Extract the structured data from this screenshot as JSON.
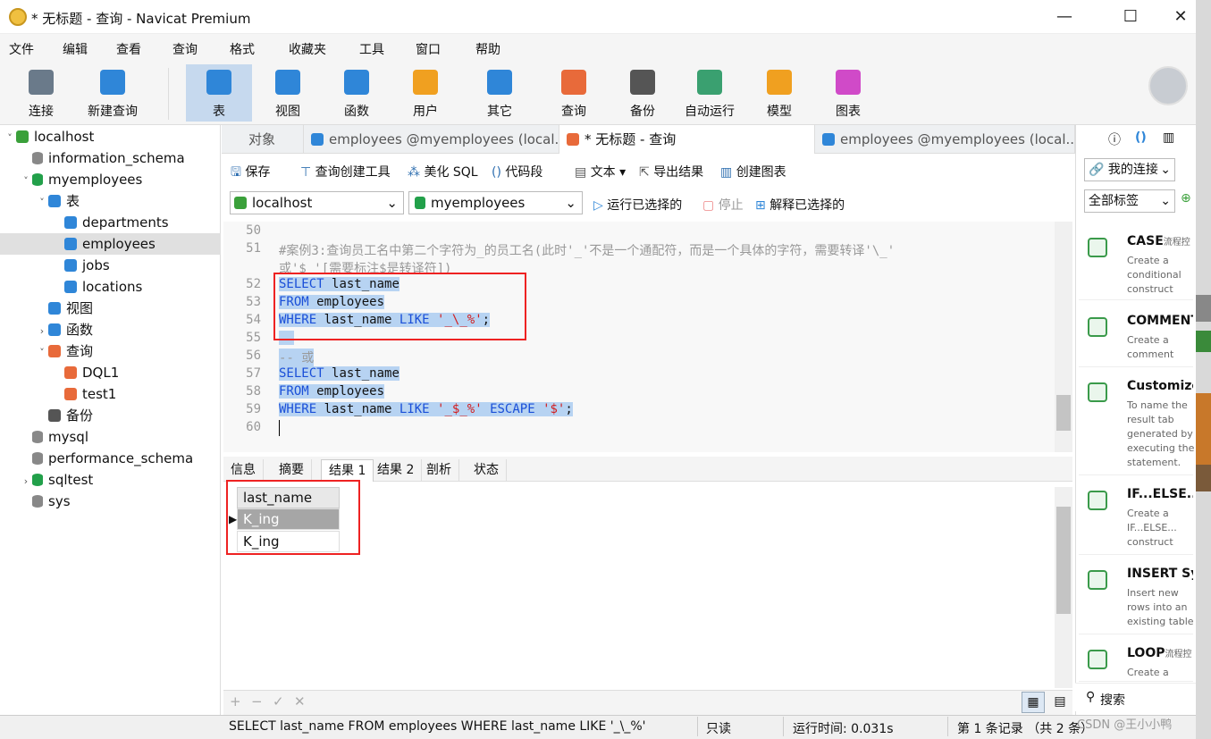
{
  "window": {
    "title": "* 无标题 - 查询 - Navicat Premium",
    "minimize": "—",
    "maximize": "☐",
    "close": "✕"
  },
  "menu": [
    "文件",
    "编辑",
    "查看",
    "查询",
    "格式",
    "收藏夹",
    "工具",
    "窗口",
    "帮助"
  ],
  "toolbar": [
    {
      "label": "连接",
      "icon": "plug-icon",
      "color": "#6a7a8a"
    },
    {
      "label": "新建查询",
      "icon": "new-query-icon",
      "color": "#2f86d8"
    },
    {
      "label": "表",
      "icon": "table-icon",
      "color": "#2f86d8"
    },
    {
      "label": "视图",
      "icon": "view-icon",
      "color": "#2f86d8"
    },
    {
      "label": "函数",
      "icon": "function-icon",
      "color": "#2f86d8"
    },
    {
      "label": "用户",
      "icon": "user-icon",
      "color": "#f0a020"
    },
    {
      "label": "其它",
      "icon": "tools-icon",
      "color": "#2f86d8"
    },
    {
      "label": "查询",
      "icon": "query-icon",
      "color": "#e86a3a"
    },
    {
      "label": "备份",
      "icon": "backup-icon",
      "color": "#555555"
    },
    {
      "label": "自动运行",
      "icon": "robot-icon",
      "color": "#3aa070"
    },
    {
      "label": "模型",
      "icon": "model-icon",
      "color": "#f0a020"
    },
    {
      "label": "图表",
      "icon": "chart-icon",
      "color": "#d04ac8"
    }
  ],
  "sidebar": [
    {
      "label": "localhost",
      "indent": 0,
      "arrow": "˅",
      "icon": "connection-icon",
      "color": "#3aa03a"
    },
    {
      "label": "information_schema",
      "indent": 1,
      "arrow": "",
      "icon": "database-icon",
      "color": "#888888"
    },
    {
      "label": "myemployees",
      "indent": 1,
      "arrow": "˅",
      "icon": "database-icon",
      "color": "#22a04a"
    },
    {
      "label": "表",
      "indent": 2,
      "arrow": "˅",
      "icon": "tables-folder-icon",
      "color": "#2f86d8"
    },
    {
      "label": "departments",
      "indent": 3,
      "arrow": "",
      "icon": "table-icon",
      "color": "#2f86d8"
    },
    {
      "label": "employees",
      "indent": 3,
      "arrow": "",
      "icon": "table-icon",
      "color": "#2f86d8",
      "selected": true
    },
    {
      "label": "jobs",
      "indent": 3,
      "arrow": "",
      "icon": "table-icon",
      "color": "#2f86d8"
    },
    {
      "label": "locations",
      "indent": 3,
      "arrow": "",
      "icon": "table-icon",
      "color": "#2f86d8"
    },
    {
      "label": "视图",
      "indent": 2,
      "arrow": "",
      "icon": "view-icon",
      "color": "#2f86d8"
    },
    {
      "label": "函数",
      "indent": 2,
      "arrow": "›",
      "icon": "function-icon",
      "color": "#2f86d8"
    },
    {
      "label": "查询",
      "indent": 2,
      "arrow": "˅",
      "icon": "query-icon",
      "color": "#e86a3a"
    },
    {
      "label": "DQL1",
      "indent": 3,
      "arrow": "",
      "icon": "query-icon",
      "color": "#e86a3a"
    },
    {
      "label": "test1",
      "indent": 3,
      "arrow": "",
      "icon": "query-icon",
      "color": "#e86a3a"
    },
    {
      "label": "备份",
      "indent": 2,
      "arrow": "",
      "icon": "backup-icon",
      "color": "#555555"
    },
    {
      "label": "mysql",
      "indent": 1,
      "arrow": "",
      "icon": "database-icon",
      "color": "#888888"
    },
    {
      "label": "performance_schema",
      "indent": 1,
      "arrow": "",
      "icon": "database-icon",
      "color": "#888888"
    },
    {
      "label": "sqltest",
      "indent": 1,
      "arrow": "›",
      "icon": "database-icon",
      "color": "#22a04a"
    },
    {
      "label": "sys",
      "indent": 1,
      "arrow": "",
      "icon": "database-icon",
      "color": "#888888"
    }
  ],
  "tabs": {
    "objects": "对象",
    "tab1": "employees @myemployees (local...",
    "tab2": "* 无标题 - 查询",
    "tab3": "employees @myemployees (local..."
  },
  "query_toolbar": {
    "save": "保存",
    "builder": "查询创建工具",
    "beautify": "美化 SQL",
    "snippet": "代码段",
    "text": "文本",
    "export": "导出结果",
    "create_chart": "创建图表"
  },
  "selectors": {
    "connection": "localhost",
    "database": "myemployees",
    "run": "运行已选择的",
    "stop": "停止",
    "explain": "解释已选择的"
  },
  "editor": {
    "lines": [
      {
        "n": "50",
        "text": ""
      },
      {
        "n": "51",
        "text": "#案例3:查询员工名中第二个字符为_的员工名(此时'_'不是一个通配符，而是一个具体的字符，需要转译'\\_'"
      },
      {
        "n": "",
        "text": "或'$ '[需要标注$是转译符])"
      },
      {
        "n": "52",
        "text": "SELECT last_name"
      },
      {
        "n": "53",
        "text": "FROM employees"
      },
      {
        "n": "54",
        "text": "WHERE last_name LIKE '_\\_%';"
      },
      {
        "n": "55",
        "text": ""
      },
      {
        "n": "56",
        "text": "-- 或"
      },
      {
        "n": "57",
        "text": "SELECT last_name"
      },
      {
        "n": "58",
        "text": "FROM employees"
      },
      {
        "n": "59",
        "text": "WHERE last_name LIKE '_$_%' ESCAPE '$';"
      },
      {
        "n": "60",
        "text": ""
      }
    ],
    "kw_select": "SELECT",
    "kw_from": "FROM",
    "kw_where": "WHERE",
    "kw_like": "LIKE",
    "kw_escape": "ESCAPE",
    "col": "last_name",
    "tbl": "employees",
    "str1": "'_\\_%'",
    "str2": "'_$_%'",
    "str3": "'$'",
    "semi": ";",
    "comment": "-- 或"
  },
  "result_tabs": [
    "信息",
    "摘要",
    "结果 1",
    "结果 2",
    "剖析",
    "状态"
  ],
  "result": {
    "column": "last_name",
    "rows": [
      "K_ing",
      "K_ing"
    ]
  },
  "bottom_controls": [
    "+",
    "−",
    "✓",
    "✕"
  ],
  "status": {
    "sql": "SELECT last_name FROM employees WHERE last_name LIKE '_\\_%'",
    "readonly": "只读",
    "runtime": "运行时间: 0.031s",
    "records": "第 1 条记录 （共 2 条）",
    "watermark": "CSDN @王小小鸭"
  },
  "right_panel": {
    "connection_dropdown": "我的连接",
    "tags_dropdown": "全部标签",
    "search": "搜索",
    "snippets": [
      {
        "title": "CASE",
        "suffix": "流程控",
        "desc": "Create a conditional construct"
      },
      {
        "title": "COMMENT",
        "suffix": "",
        "desc": "Create a comment"
      },
      {
        "title": "Customize",
        "suffix": "",
        "desc": "To name the result tab generated by executing the statement."
      },
      {
        "title": "IF...ELSE...",
        "suffix": "",
        "desc": "Create a IF...ELSE... construct"
      },
      {
        "title": "INSERT Sy",
        "suffix": "",
        "desc": "Insert new rows into an existing table"
      },
      {
        "title": "LOOP",
        "suffix": "流程控",
        "desc": "Create a"
      }
    ]
  }
}
